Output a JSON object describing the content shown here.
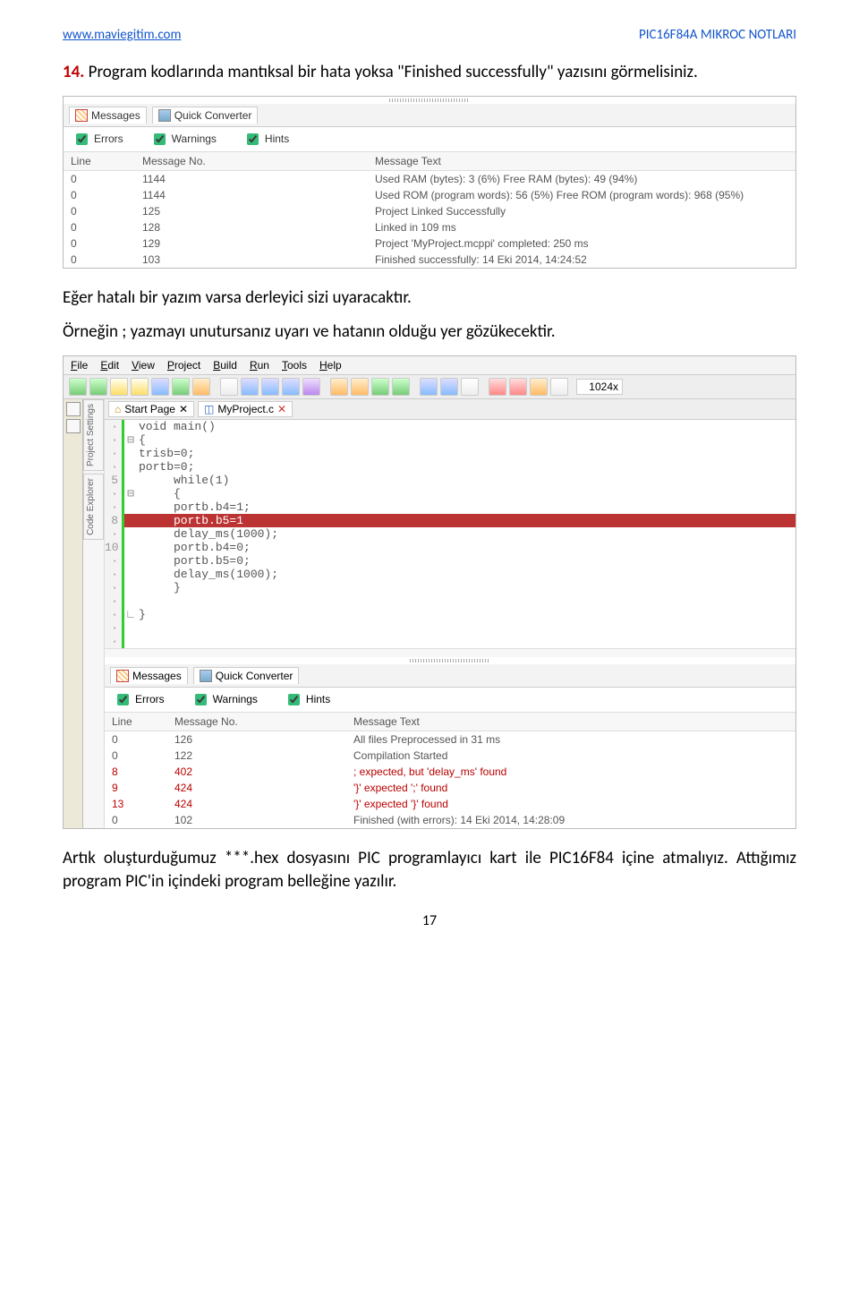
{
  "header": {
    "site_url": "www.maviegitim.com",
    "doc_title": "PIC16F84A MIKROC NOTLARI"
  },
  "step": {
    "number": "14.",
    "text": "Program kodlarında mantıksal bir hata yoksa \"Finished successfully\" yazısını görmelisiniz."
  },
  "messages_panel": {
    "tab_messages": "Messages",
    "tab_quick": "Quick Converter",
    "check_errors": "Errors",
    "check_warnings": "Warnings",
    "check_hints": "Hints",
    "col_line": "Line",
    "col_msgno": "Message No.",
    "col_msgtext": "Message Text",
    "rows": [
      {
        "line": "0",
        "no": "1144",
        "text": "Used RAM (bytes): 3 (6%)  Free RAM (bytes): 49 (94%)"
      },
      {
        "line": "0",
        "no": "1144",
        "text": "Used ROM (program words): 56 (5%)  Free ROM (program words): 968 (95%)"
      },
      {
        "line": "0",
        "no": "125",
        "text": "Project Linked Successfully"
      },
      {
        "line": "0",
        "no": "128",
        "text": "Linked in 109 ms"
      },
      {
        "line": "0",
        "no": "129",
        "text": "Project 'MyProject.mcppi' completed: 250 ms"
      },
      {
        "line": "0",
        "no": "103",
        "text": "Finished successfully: 14 Eki 2014, 14:24:52"
      }
    ]
  },
  "mid_text_1": "Eğer hatalı bir yazım varsa derleyici sizi uyaracaktır.",
  "mid_text_2": "Örneğin ; yazmayı unutursanız  uyarı ve hatanın olduğu yer gözükecektir.",
  "ide": {
    "menu": [
      "File",
      "Edit",
      "View",
      "Project",
      "Build",
      "Run",
      "Tools",
      "Help"
    ],
    "zoom": "1024x",
    "start_tab": "Start Page",
    "file_tab": "MyProject.c",
    "side_tabs": [
      "Project Settings",
      "Code Explorer"
    ],
    "code_lines": [
      {
        "g": "·",
        "n": "",
        "src": "void main()"
      },
      {
        "g": "·",
        "n": "",
        "src": "{",
        "fold": "⊟"
      },
      {
        "g": "·",
        "n": "",
        "src": "trisb=0;"
      },
      {
        "g": "·",
        "n": "",
        "src": "portb=0;"
      },
      {
        "g": "5",
        "n": "5",
        "src": "     while(1)"
      },
      {
        "g": "·",
        "n": "",
        "src": "     {",
        "fold": "⊟"
      },
      {
        "g": "·",
        "n": "",
        "src": "     portb.b4=1;"
      },
      {
        "g": "8",
        "n": "8",
        "src": "     portb.b5=1",
        "hl": true
      },
      {
        "g": "·",
        "n": "",
        "src": "     delay_ms(1000);"
      },
      {
        "g": "10",
        "n": "10",
        "src": "     portb.b4=0;"
      },
      {
        "g": "·",
        "n": "",
        "src": "     portb.b5=0;"
      },
      {
        "g": "·",
        "n": "",
        "src": "     delay_ms(1000);"
      },
      {
        "g": "·",
        "n": "",
        "src": "     }"
      },
      {
        "g": "·",
        "n": "",
        "src": ""
      },
      {
        "g": "·",
        "n": "",
        "src": "}",
        "fold": "∟"
      },
      {
        "g": "·",
        "n": "",
        "src": ""
      },
      {
        "g": "·",
        "n": "",
        "src": ""
      }
    ],
    "msgs": {
      "rows": [
        {
          "line": "0",
          "no": "126",
          "text": "All files Preprocessed in 31 ms"
        },
        {
          "line": "0",
          "no": "122",
          "text": "Compilation Started"
        },
        {
          "line": "8",
          "no": "402",
          "text": "; expected, but 'delay_ms' found",
          "err": true
        },
        {
          "line": "9",
          "no": "424",
          "text": "'}' expected ';' found",
          "err": true
        },
        {
          "line": "13",
          "no": "424",
          "text": "'}' expected '}' found",
          "err": true
        },
        {
          "line": "0",
          "no": "102",
          "text": "Finished (with errors): 14 Eki 2014, 14:28:09"
        }
      ]
    }
  },
  "tail_text": "Artık oluşturduğumuz ***.hex dosyasını PIC programlayıcı kart ile PIC16F84 içine atmalıyız. Attığımız program PIC'in içindeki program belleğine yazılır.",
  "page_number": "17"
}
